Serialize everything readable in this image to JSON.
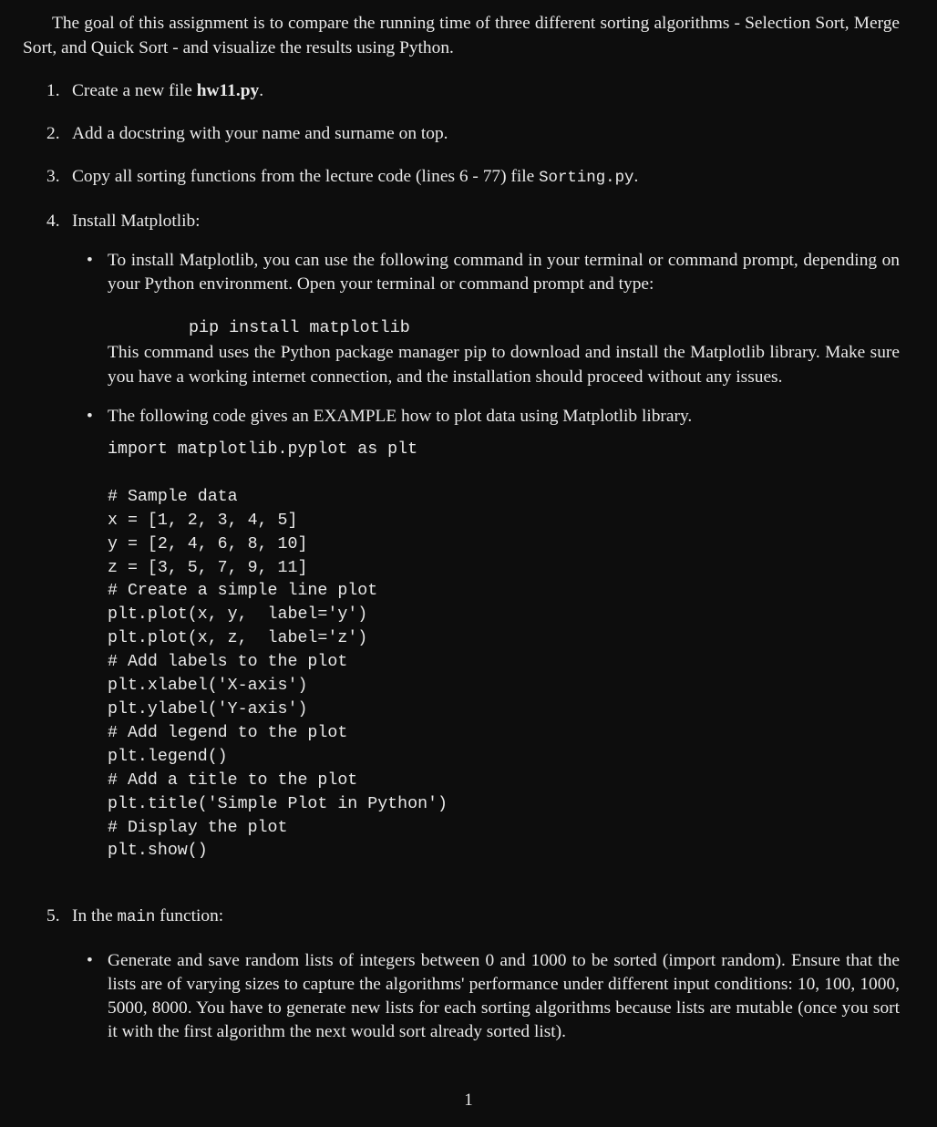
{
  "document": {
    "background_color": "#0d0d0d",
    "text_color": "#e9e9e9",
    "page_number": "1",
    "intro": "The goal of this assignment is to compare the running time of three different sorting algorithms - Selection Sort, Merge Sort, and Quick Sort - and visualize the results using Python."
  },
  "items": {
    "item1": {
      "marker": "1.",
      "text_before": "Create a new file ",
      "code": "hw11.py",
      "text_after": "."
    },
    "item2": {
      "marker": "2.",
      "text": "Add a docstring with your name and surname on top."
    },
    "item3": {
      "marker": "3.",
      "text_before": "Copy all sorting functions from the lecture code (lines 6 - 77) file ",
      "code": "Sorting.py",
      "text_after": "."
    },
    "item4": {
      "marker": "4.",
      "text": "Install Matplotlib:",
      "bullets": {
        "b1": {
          "text": "To install Matplotlib, you can use the following command in your terminal or command prompt, depending on your Python environment. Open your terminal or command prompt and type:",
          "command": "pip install matplotlib",
          "followup": "This command uses the Python package manager pip to download and install the Matplotlib library. Make sure you have a working internet connection, and the installation should proceed without any issues."
        },
        "b2": {
          "text": "The following code gives an EXAMPLE how to plot data using Matplotlib library.",
          "code": "import matplotlib.pyplot as plt\n\n# Sample data\nx = [1, 2, 3, 4, 5]\ny = [2, 4, 6, 8, 10]\nz = [3, 5, 7, 9, 11]\n# Create a simple line plot\nplt.plot(x, y,  label='y')\nplt.plot(x, z,  label='z')\n# Add labels to the plot\nplt.xlabel('X-axis')\nplt.ylabel('Y-axis')\n# Add legend to the plot\nplt.legend()\n# Add a title to the plot\nplt.title('Simple Plot in Python')\n# Display the plot\nplt.show()"
        }
      }
    },
    "item5": {
      "marker": "5.",
      "text_before": "In the ",
      "code": "main",
      "text_after": " function:",
      "bullets": {
        "b1": {
          "text": "Generate and save random lists of integers between 0 and 1000 to be sorted (import random). Ensure that the lists are of varying sizes to capture the algorithms' performance under different input conditions: 10, 100, 1000, 5000, 8000. You have to generate new lists for each sorting algorithms because lists are mutable (once you sort it with the first algorithm the next would sort already sorted list)."
        }
      }
    }
  },
  "icons": {
    "bullet_glyph": "•"
  }
}
